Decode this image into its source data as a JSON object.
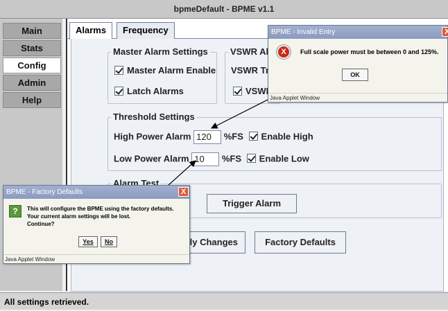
{
  "window": {
    "title": "bpmeDefault - BPME v1.1"
  },
  "sidebar": {
    "items": [
      {
        "label": "Main",
        "active": false
      },
      {
        "label": "Stats",
        "active": false
      },
      {
        "label": "Config",
        "active": true
      },
      {
        "label": "Admin",
        "active": false
      },
      {
        "label": "Help",
        "active": false
      }
    ]
  },
  "tabs": [
    {
      "label": "Alarms",
      "selected": true
    },
    {
      "label": "Frequency",
      "selected": false
    }
  ],
  "master_alarm": {
    "group_title": "Master Alarm Settings",
    "master_enable_label": "Master Alarm Enable",
    "latch_label": "Latch Alarms"
  },
  "vswr": {
    "group_title": "VSWR Al",
    "trip_label": "VSWR Tri",
    "enable_label": "VSWF"
  },
  "threshold": {
    "group_title": "Threshold Settings",
    "high_label": "High Power Alarm",
    "high_value": "120",
    "high_unit": "%FS",
    "high_enable_label": "Enable High",
    "low_label": "Low Power Alarm",
    "low_value": "10",
    "low_unit": "%FS",
    "low_enable_label": "Enable Low"
  },
  "alarm_test": {
    "group_title": "Alarm Test",
    "trigger_label": "Trigger Alarm"
  },
  "actions": {
    "apply_label": "Apply Changes",
    "apply_visible": "ply Changes",
    "factory_label": "Factory Defaults"
  },
  "status": {
    "text": "All settings retrieved."
  },
  "invalid_dialog": {
    "title": "BPME - Invalid Entry",
    "message": "Full scale power must be between 0 and 125%.",
    "ok_label": "OK",
    "footer": "Java Applet Window",
    "close_glyph": "X",
    "error_glyph": "X"
  },
  "factory_dialog": {
    "title": "BPME - Factory Defaults",
    "line1": "This will configure the BPME using the factory defaults.",
    "line2": "Your current alarm settings will be lost.",
    "line3": "Continue?",
    "yes_label": "Yes",
    "no_label": "No",
    "footer": "Java Applet Window",
    "close_glyph": "X",
    "question_glyph": "?"
  },
  "colors": {
    "accent": "#8a99bf",
    "error": "#cc2a1a",
    "question": "#5a9a3a"
  }
}
